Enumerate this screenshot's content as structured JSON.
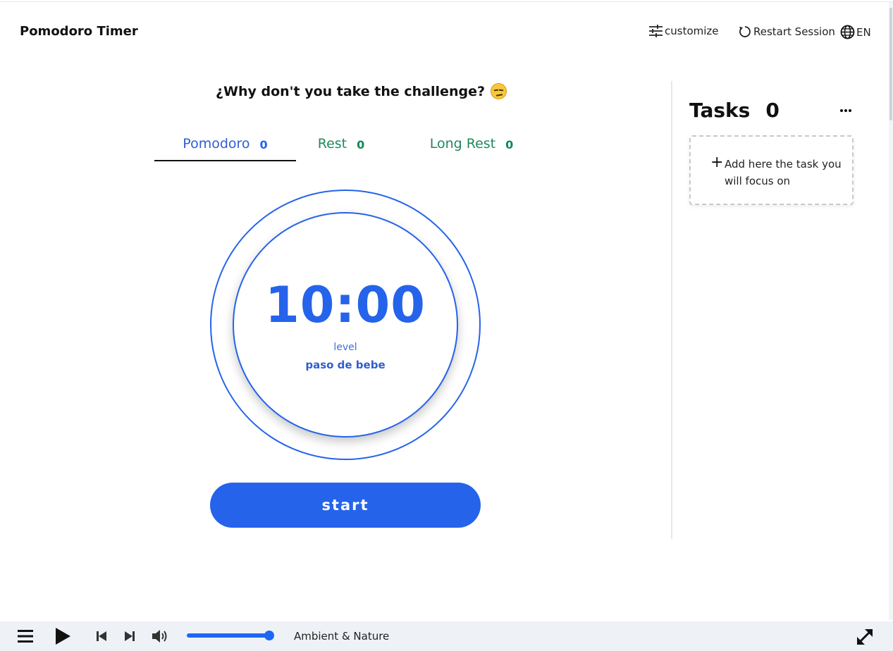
{
  "header": {
    "title": "Pomodoro Timer",
    "customize_label": "customize",
    "restart_label": "Restart Session",
    "language_label": "EN"
  },
  "challenge": {
    "text": "¿Why don't you take the challenge?",
    "emoji": "unamused-face-icon"
  },
  "tabs": [
    {
      "label": "Pomodoro",
      "count": "0",
      "active": true
    },
    {
      "label": "Rest",
      "count": "0",
      "active": false
    },
    {
      "label": "Long Rest",
      "count": "0",
      "active": false
    }
  ],
  "timer": {
    "time": "10:00",
    "level_label": "level",
    "level_value": "paso de bebe"
  },
  "start_label": "start",
  "tasks": {
    "title": "Tasks",
    "count": "0",
    "add_text": "Add here the task you will focus on"
  },
  "player": {
    "station": "Ambient & Nature",
    "volume": 0.92
  },
  "colors": {
    "accent": "#2563eb",
    "rest": "#1d8a5c",
    "player_bg": "#eef2f7"
  }
}
